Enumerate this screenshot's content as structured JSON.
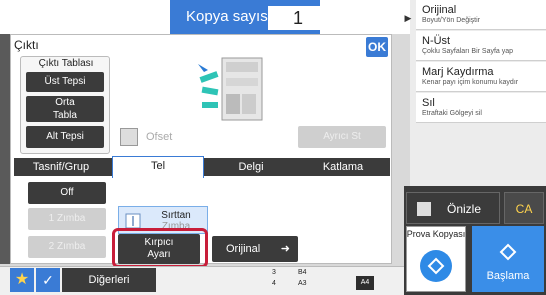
{
  "copy": {
    "label": "Kopya sayısı",
    "value": "1"
  },
  "right_panel": {
    "items": [
      {
        "title": "Orijinal",
        "subtitle": "Boyut/Yön Değiştir"
      },
      {
        "title": "N-Üst",
        "subtitle": "Çoklu Sayfaları Bir Sayfa yap"
      },
      {
        "title": "Marj Kaydırma",
        "subtitle": "Kenar payı içim konumu kaydır"
      },
      {
        "title": "Sıl",
        "subtitle": "Etraftaki Gölgeyi sil"
      }
    ],
    "preview_label": "Önizle",
    "ca_label": "CA",
    "proof_label": "Prova Kopyası",
    "start_label": "Başlama"
  },
  "dialog": {
    "title": "Çıktı",
    "ok_label": "OK",
    "tray_label": "Çıktı Tablası",
    "trays": [
      "Üst Tepsi",
      "Orta Tabla",
      "Alt Tepsi"
    ],
    "offset_label": "Ofset",
    "separate_label": "Ayrıcı St",
    "tabs": [
      "Tasnif/Grup",
      "Tel",
      "Delgi",
      "Katlama"
    ],
    "active_tab": "Tel",
    "staple_off": "Off",
    "staple_1": "1 Zımba",
    "staple_2": "2 Zımba",
    "back_label": "Sırttan",
    "back_sub": "Zımba",
    "kirpici_label": "Kırpıcı Ayarı",
    "original_label": "Orijinal"
  },
  "bottom": {
    "others_label": "Diğerleri",
    "tray_rows": [
      {
        "num": "3",
        "size": "B4"
      },
      {
        "num": "4",
        "size": "A3"
      }
    ],
    "paper_size": "A4"
  },
  "colors": {
    "accent": "#3a7bd5",
    "highlight": "#c81e3a",
    "dark": "#3b3b3b"
  }
}
